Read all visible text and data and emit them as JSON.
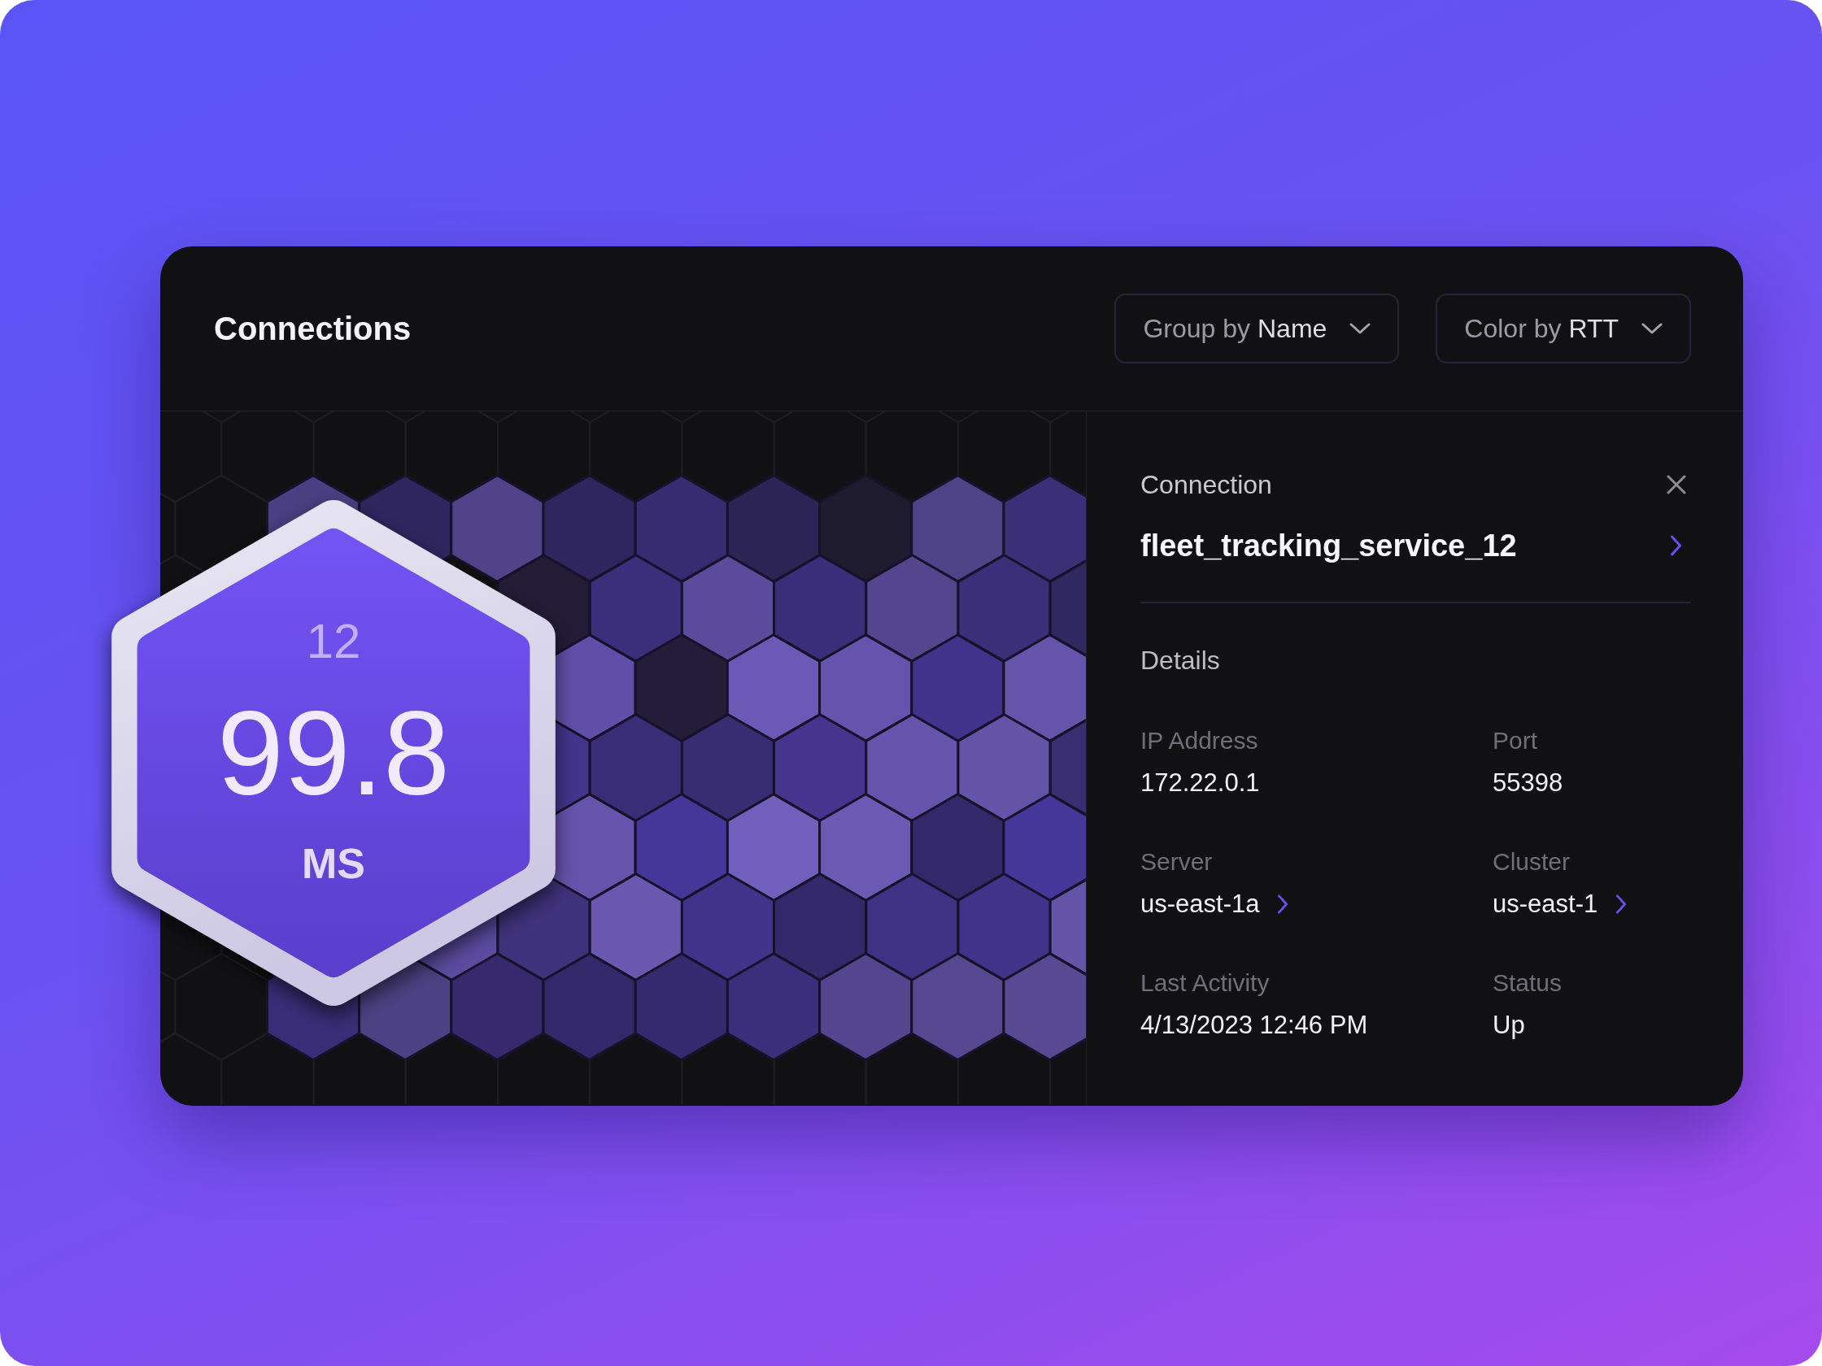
{
  "header": {
    "title": "Connections",
    "dropdowns": [
      {
        "label": "Group by",
        "value": "Name"
      },
      {
        "label": "Color by",
        "value": "RTT"
      }
    ]
  },
  "hex_tooltip": {
    "count": "12",
    "value": "99.8",
    "unit": "MS"
  },
  "detail_panel": {
    "section_title": "Connection",
    "connection_name": "fleet_tracking_service_12",
    "details_title": "Details",
    "fields": [
      {
        "label": "IP Address",
        "value": "172.22.0.1",
        "kind": "text"
      },
      {
        "label": "Port",
        "value": "55398",
        "kind": "text"
      },
      {
        "label": "Server",
        "value": "us-east-1a",
        "kind": "link"
      },
      {
        "label": "Cluster",
        "value": "us-east-1",
        "kind": "link"
      },
      {
        "label": "Last Activity",
        "value": "4/13/2023 12:46 PM",
        "kind": "text"
      },
      {
        "label": "Status",
        "value": "Up",
        "kind": "text"
      }
    ]
  }
}
